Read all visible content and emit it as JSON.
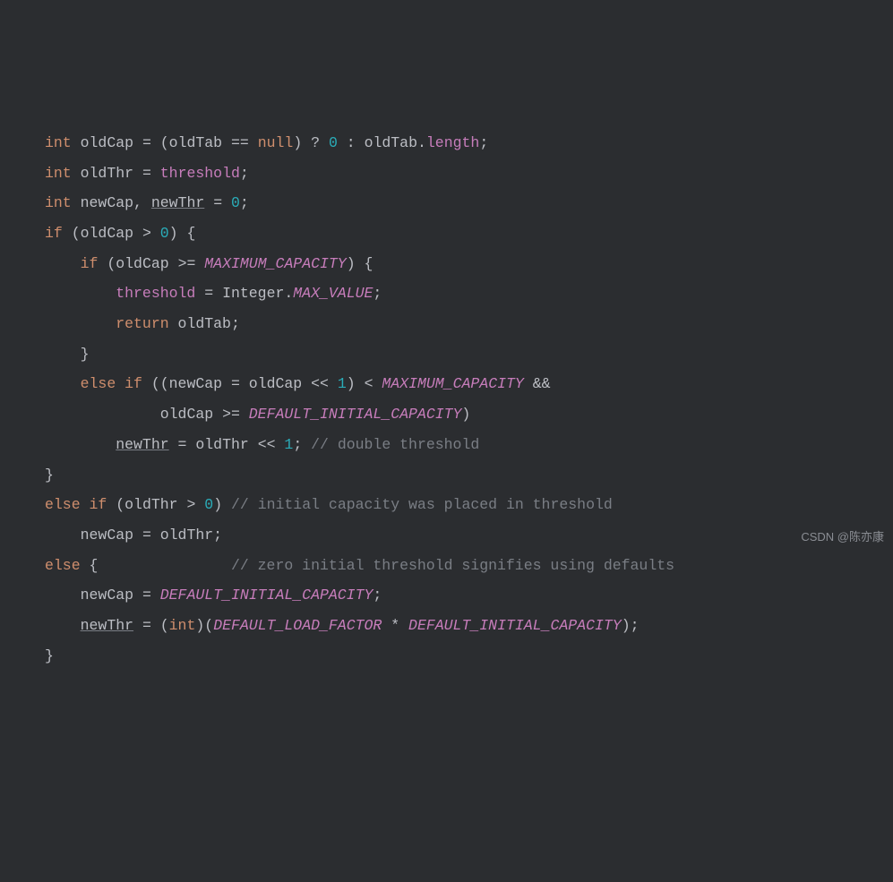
{
  "code": {
    "l1": {
      "kw": "int",
      "v": "oldCap",
      "eq": "=",
      "lp": "(",
      "id2": "oldTab",
      "eqeq": "==",
      "null": "null",
      "rp": ")",
      "q": "?",
      "zero": "0",
      "colon": ":",
      "id3": "oldTab",
      "dot": ".",
      "field": "length",
      "semi": ";"
    },
    "l2": {
      "kw": "int",
      "v": "oldThr",
      "eq": "=",
      "field": "threshold",
      "semi": ";"
    },
    "l3": {
      "kw": "int",
      "v1": "newCap",
      "comma": ",",
      "v2": "newThr",
      "eq": "=",
      "zero": "0",
      "semi": ";"
    },
    "l4": {
      "kw": "if",
      "lp": "(",
      "v": "oldCap",
      "gt": ">",
      "zero": "0",
      "rp": ")",
      "lb": "{"
    },
    "l5": {
      "kw": "if",
      "lp": "(",
      "v": "oldCap",
      "ge": ">=",
      "const": "MAXIMUM_CAPACITY",
      "rp": ")",
      "lb": "{"
    },
    "l6": {
      "field": "threshold",
      "eq": "=",
      "cls": "Integer",
      "dot": ".",
      "const": "MAX_VALUE",
      "semi": ";"
    },
    "l7": {
      "kw": "return",
      "v": "oldTab",
      "semi": ";"
    },
    "l8": {
      "rb": "}"
    },
    "l9": {
      "kw1": "else",
      "kw2": "if",
      "lp": "((",
      "v1": "newCap",
      "eq": "=",
      "v2": "oldCap",
      "shl": "<<",
      "one": "1",
      "rp1": ")",
      "lt": "<",
      "const": "MAXIMUM_CAPACITY",
      "amp": "&&"
    },
    "l10": {
      "v": "oldCap",
      "ge": ">=",
      "const": "DEFAULT_INITIAL_CAPACITY",
      "rp": ")"
    },
    "l11": {
      "v1": "newThr",
      "eq": "=",
      "v2": "oldThr",
      "shl": "<<",
      "one": "1",
      "semi": ";",
      "cmt": "// double threshold"
    },
    "l12": {
      "rb": "}"
    },
    "l13": {
      "kw1": "else",
      "kw2": "if",
      "lp": "(",
      "v": "oldThr",
      "gt": ">",
      "zero": "0",
      "rp": ")",
      "cmt": "// initial capacity was placed in threshold"
    },
    "l14": {
      "v1": "newCap",
      "eq": "=",
      "v2": "oldThr",
      "semi": ";"
    },
    "l15": {
      "kw": "else",
      "lb": "{",
      "cmt": "// zero initial threshold signifies using defaults"
    },
    "l16": {
      "v": "newCap",
      "eq": "=",
      "const": "DEFAULT_INITIAL_CAPACITY",
      "semi": ";"
    },
    "l17": {
      "v": "newThr",
      "eq": "=",
      "lp": "(",
      "kw": "int",
      "rp": ")(",
      "const1": "DEFAULT_LOAD_FACTOR",
      "mul": "*",
      "const2": "DEFAULT_INITIAL_CAPACITY",
      "rp2": ")",
      "semi": ";"
    },
    "l18": {
      "rb": "}"
    }
  },
  "watermark": "CSDN @陈亦康"
}
